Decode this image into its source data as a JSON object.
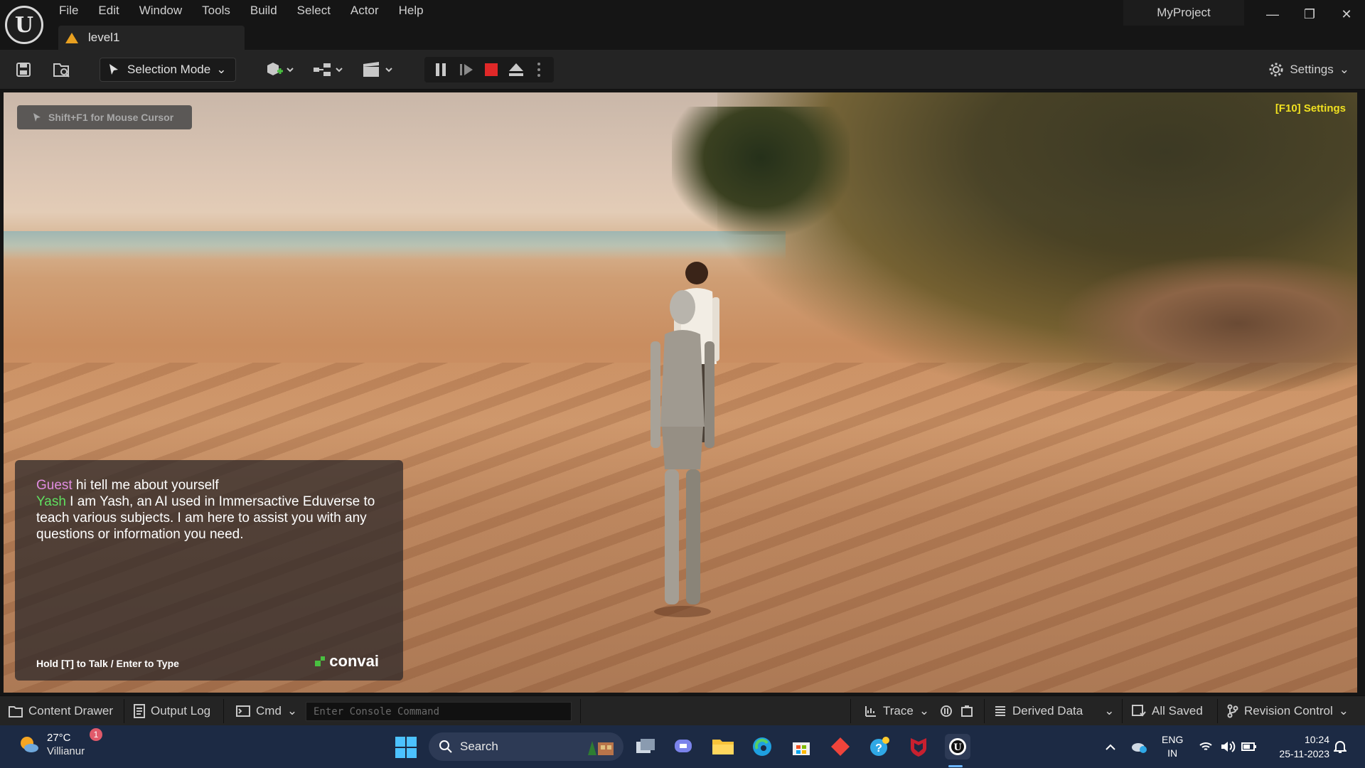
{
  "menu": [
    "File",
    "Edit",
    "Window",
    "Tools",
    "Build",
    "Select",
    "Actor",
    "Help"
  ],
  "document_tab": {
    "label": "level1"
  },
  "project": {
    "name": "MyProject"
  },
  "window_controls": {
    "minimize": "—",
    "restore": "❐",
    "close": "✕"
  },
  "toolbar": {
    "selection_mode": "Selection Mode",
    "settings": "Settings"
  },
  "viewport": {
    "mouse_hint": "Shift+F1 for Mouse Cursor",
    "f10_settings": "[F10] Settings",
    "chat": {
      "lines": [
        {
          "speaker": "Guest",
          "text": " hi tell me about yourself"
        },
        {
          "speaker": "Yash",
          "text": "  I am Yash, an AI used in Immersactive Eduverse to teach various subjects.  I am here to assist you with any questions or information you need."
        }
      ],
      "hint": "Hold [T] to Talk / Enter to Type",
      "brand": "convai"
    }
  },
  "statusbar": {
    "content_drawer": "Content Drawer",
    "output_log": "Output Log",
    "cmd": "Cmd",
    "console_placeholder": "Enter Console Command",
    "trace": "Trace",
    "derived_data": "Derived Data",
    "all_saved": "All Saved",
    "revision_control": "Revision Control"
  },
  "taskbar": {
    "weather": {
      "temp": "27°C",
      "location": "Villianur",
      "badge": "1"
    },
    "search_label": "Search",
    "tray": {
      "lang_top": "ENG",
      "lang_bottom": "IN"
    },
    "clock": {
      "time": "10:24",
      "date": "25-11-2023"
    }
  }
}
